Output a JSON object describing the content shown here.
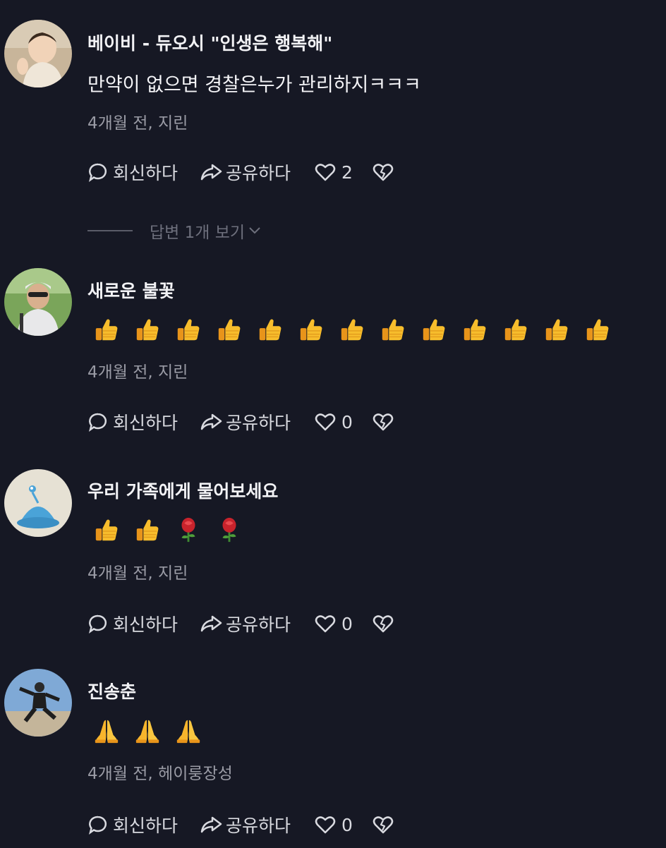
{
  "comments": [
    {
      "username": "베이비 - 듀오시 \"인생은 행복해\"",
      "text": "만약이 없으면 경찰은누가 관리하지ㅋㅋㅋ",
      "emojis": [],
      "meta": "4개월 전, 지린",
      "reply_label": "회신하다",
      "share_label": "공유하다",
      "like_count": "2",
      "replies_label": "답변 1개 보기"
    },
    {
      "username": "새로운 불꽃",
      "text": "",
      "emojis": [
        "thumbs-up",
        "thumbs-up",
        "thumbs-up",
        "thumbs-up",
        "thumbs-up",
        "thumbs-up",
        "thumbs-up",
        "thumbs-up",
        "thumbs-up",
        "thumbs-up",
        "thumbs-up",
        "thumbs-up",
        "thumbs-up"
      ],
      "meta": "4개월 전, 지린",
      "reply_label": "회신하다",
      "share_label": "공유하다",
      "like_count": "0"
    },
    {
      "username": "우리 가족에게 물어보세요",
      "text": "",
      "emojis": [
        "thumbs-up",
        "thumbs-up",
        "rose",
        "rose"
      ],
      "meta": "4개월 전, 지린",
      "reply_label": "회신하다",
      "share_label": "공유하다",
      "like_count": "0"
    },
    {
      "username": "진송춘",
      "text": "",
      "emojis": [
        "folded-hands",
        "folded-hands",
        "folded-hands"
      ],
      "meta": "4개월 전, 헤이룽장성",
      "reply_label": "회신하다",
      "share_label": "공유하다",
      "like_count": "0"
    }
  ],
  "colors": {
    "background": "#161824",
    "meta_text": "#9a9ba5",
    "emoji_thumb": "#f5b52a",
    "emoji_rose": "#c8232c"
  }
}
